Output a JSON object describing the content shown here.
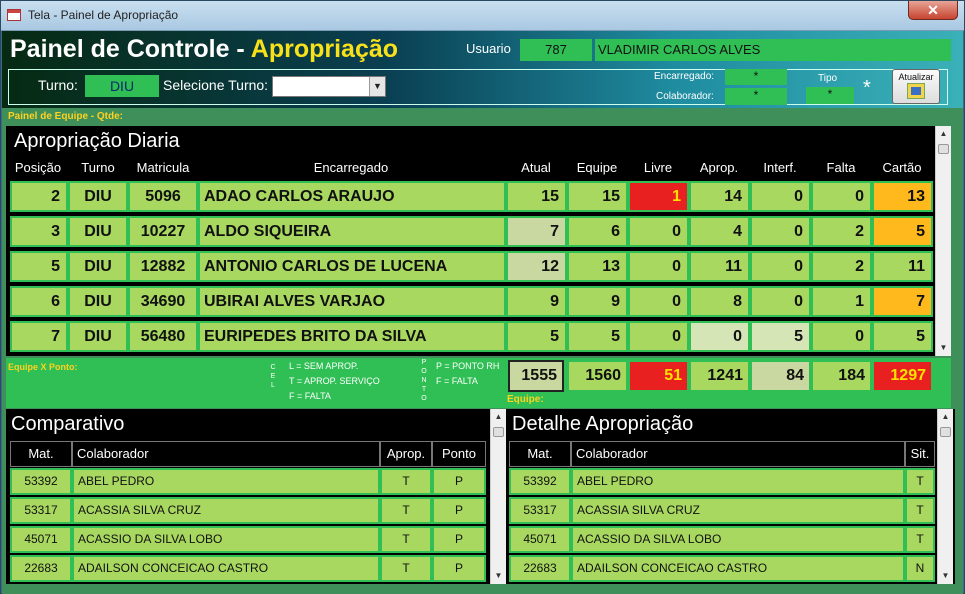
{
  "window": {
    "title": "Tela - Painel de Apropriação",
    "close_label": "✕"
  },
  "header": {
    "title_white": "Painel de Controle - ",
    "title_yellow": "Apropriação",
    "usuario_label": "Usuario",
    "usuario_code": "787",
    "usuario_name": "VLADIMIR CARLOS ALVES",
    "turno_label": "Turno:",
    "turno_value": "DIU",
    "selecione_label": "Selecione Turno:",
    "selecione_value": "",
    "encarregado_label": "Encarregado:",
    "encarregado_value": "*",
    "colaborador_label": "Colaborador:",
    "colaborador_value": "*",
    "tipo_label": "Tipo",
    "tipo_value": "*",
    "asterisk": "*",
    "atualizar_label": "Atualizar"
  },
  "sections": {
    "painel_equipe": "Painel de Equipe - Qtde:",
    "equipe_ponto": "Equipe X Ponto:",
    "equipe": "Equipe:"
  },
  "daily": {
    "title": "Apropriação Diaria",
    "columns": [
      "Posição",
      "Turno",
      "Matricula",
      "Encarregado",
      "Atual",
      "Equipe",
      "Livre",
      "Aprop.",
      "Interf.",
      "Falta",
      "Cartão"
    ],
    "rows": [
      {
        "pos": "2",
        "turno": "DIU",
        "matricula": "5096",
        "encarregado": "ADAO CARLOS ARAUJO",
        "atual": "15",
        "equipe": "15",
        "livre": "1",
        "aprop": "14",
        "interf": "0",
        "falta": "0",
        "cartao": "13"
      },
      {
        "pos": "3",
        "turno": "DIU",
        "matricula": "10227",
        "encarregado": "ALDO SIQUEIRA",
        "atual": "7",
        "equipe": "6",
        "livre": "0",
        "aprop": "4",
        "interf": "0",
        "falta": "2",
        "cartao": "5"
      },
      {
        "pos": "5",
        "turno": "DIU",
        "matricula": "12882",
        "encarregado": "ANTONIO CARLOS DE LUCENA",
        "atual": "12",
        "equipe": "13",
        "livre": "0",
        "aprop": "11",
        "interf": "0",
        "falta": "2",
        "cartao": "11"
      },
      {
        "pos": "6",
        "turno": "DIU",
        "matricula": "34690",
        "encarregado": "UBIRAI ALVES VARJAO",
        "atual": "9",
        "equipe": "9",
        "livre": "0",
        "aprop": "8",
        "interf": "0",
        "falta": "1",
        "cartao": "7"
      },
      {
        "pos": "7",
        "turno": "DIU",
        "matricula": "56480",
        "encarregado": "EURIPEDES BRITO DA SILVA",
        "atual": "5",
        "equipe": "5",
        "livre": "0",
        "aprop": "0",
        "interf": "5",
        "falta": "0",
        "cartao": "5"
      }
    ]
  },
  "legend": {
    "cel": "C E L",
    "ponto": "P O N T O",
    "l": "L = SEM APROP.",
    "t": "T = APROP. SERVIÇO",
    "f": "F = FALTA",
    "p_rh": "P = PONTO RH",
    "f_falta": "F = FALTA"
  },
  "totals": {
    "atual": "1555",
    "equipe": "1560",
    "livre": "51",
    "aprop": "1241",
    "interf": "84",
    "falta": "184",
    "cartao": "1297"
  },
  "comparativo": {
    "title": "Comparativo",
    "columns": [
      "Mat.",
      "Colaborador",
      "Aprop.",
      "Ponto"
    ],
    "rows": [
      {
        "mat": "53392",
        "colaborador": "ABEL PEDRO",
        "aprop": "T",
        "ponto": "P"
      },
      {
        "mat": "53317",
        "colaborador": "ACASSIA SILVA CRUZ",
        "aprop": "T",
        "ponto": "P"
      },
      {
        "mat": "45071",
        "colaborador": "ACASSIO DA SILVA LOBO",
        "aprop": "T",
        "ponto": "P"
      },
      {
        "mat": "22683",
        "colaborador": "ADAILSON CONCEICAO CASTRO",
        "aprop": "T",
        "ponto": "P"
      }
    ]
  },
  "detalhe": {
    "title": "Detalhe Apropriação",
    "columns": [
      "Mat.",
      "Colaborador",
      "Sit."
    ],
    "rows": [
      {
        "mat": "53392",
        "colaborador": "ABEL PEDRO",
        "sit": "T"
      },
      {
        "mat": "53317",
        "colaborador": "ACASSIA SILVA CRUZ",
        "sit": "T"
      },
      {
        "mat": "45071",
        "colaborador": "ACASSIO DA SILVA LOBO",
        "sit": "T"
      },
      {
        "mat": "22683",
        "colaborador": "ADAILSON CONCEICAO CASTRO",
        "sit": "N"
      }
    ]
  },
  "colors": {
    "green": "#2fbf55",
    "row": "#a8d860",
    "red": "#e82020",
    "orange": "#ffb91c",
    "yellow": "#ffd21f"
  }
}
